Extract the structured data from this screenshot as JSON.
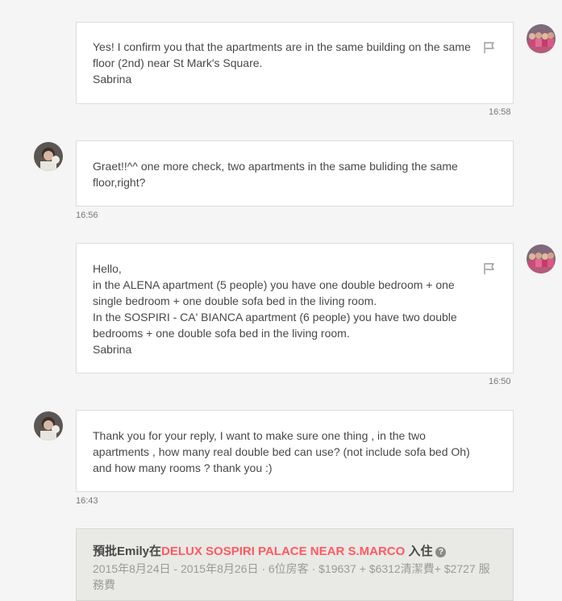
{
  "messages": [
    {
      "side": "host",
      "text": "Yes! I confirm you that the apartments are in the same building on the same floor (2nd) near St Mark's Square.\nSabrina",
      "time": "16:58"
    },
    {
      "side": "guest",
      "text": "Graet!!^^ one more check, two apartments in the same buliding the same floor,right?",
      "time": "16:56"
    },
    {
      "side": "host",
      "text": "Hello,\nin the ALENA apartment (5 people) you have one double bedroom + one single bedroom + one double sofa bed in the living room.\nIn the SOSPIRI - CA' BIANCA apartment (6 people) you have two double bedrooms + one double sofa bed in the living room.\nSabrina",
      "time": "16:50"
    },
    {
      "side": "guest",
      "text": "Thank you for your reply, I want to make sure one thing , in the two apartments , how many real double bed can use? (not include sofa bed Oh) and how many rooms ? thank you :)",
      "time": "16:43"
    }
  ],
  "icons": {
    "flag": "flag-icon",
    "help": "question-circle-icon",
    "host_avatar": "host-avatar",
    "guest_avatar": "guest-avatar"
  },
  "booking": {
    "prefix": "預批Emily在",
    "listing": "DELUX SOSPIRI PALACE NEAR S.MARCO",
    "suffix": " 入住",
    "help_glyph": "?",
    "details": "2015年8月24日 - 2015年8月26日 · 6位房客 · $19637 + $6312清潔費+ $2727 服務費"
  },
  "colors": {
    "accent": "#ff5a5f",
    "background": "#f5f5f5",
    "bubble": "#ffffff",
    "booking_bg": "#e9e9e6"
  }
}
